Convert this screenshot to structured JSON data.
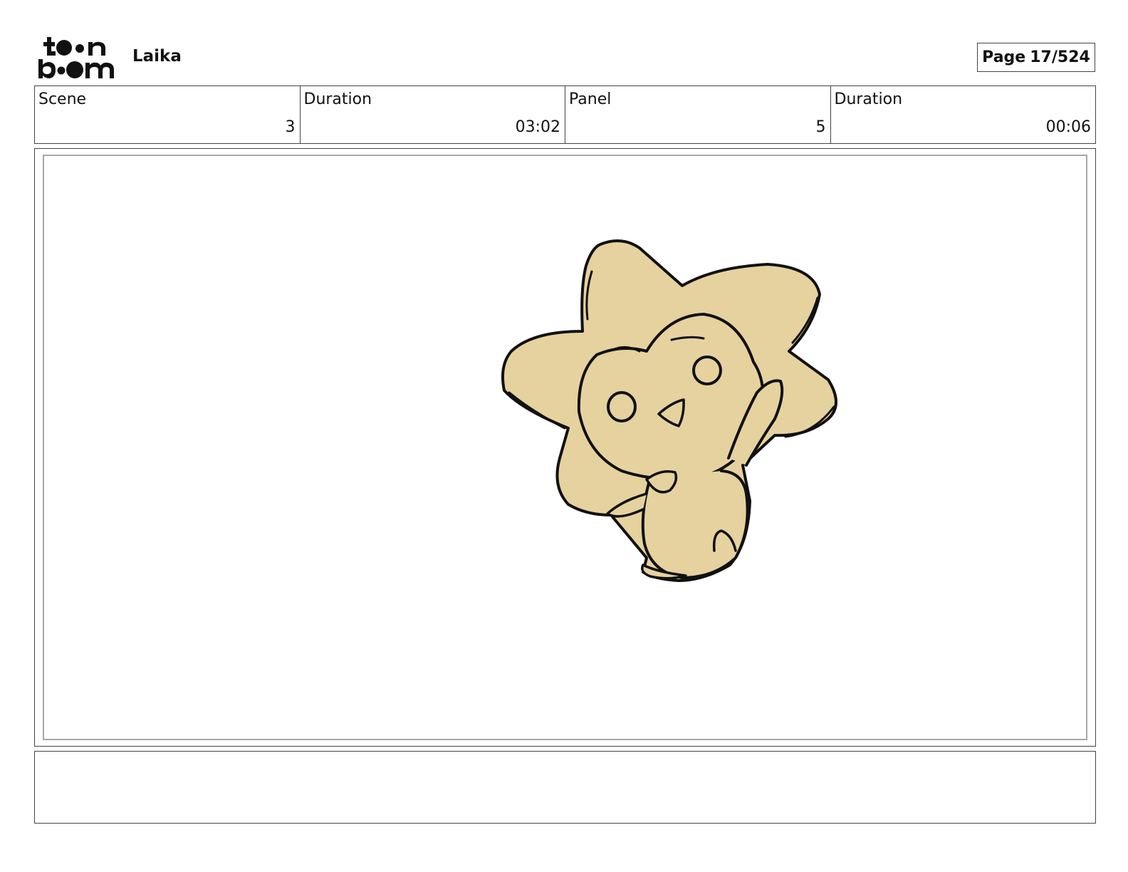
{
  "header": {
    "logo_text_top": "toon",
    "logo_text_bottom": "boom",
    "project_title": "Laika",
    "page_label": "Page",
    "page_number": "17/524"
  },
  "info": {
    "scene_label": "Scene",
    "scene_value": "3",
    "scene_duration_label": "Duration",
    "scene_duration_value": "03:02",
    "panel_label": "Panel",
    "panel_value": "5",
    "panel_duration_label": "Duration",
    "panel_duration_value": "00:06"
  },
  "dialogue": {
    "text": ""
  },
  "colors": {
    "character_fill": "#e6d29f",
    "line": "#111111",
    "frame": "#a8a8a8"
  }
}
